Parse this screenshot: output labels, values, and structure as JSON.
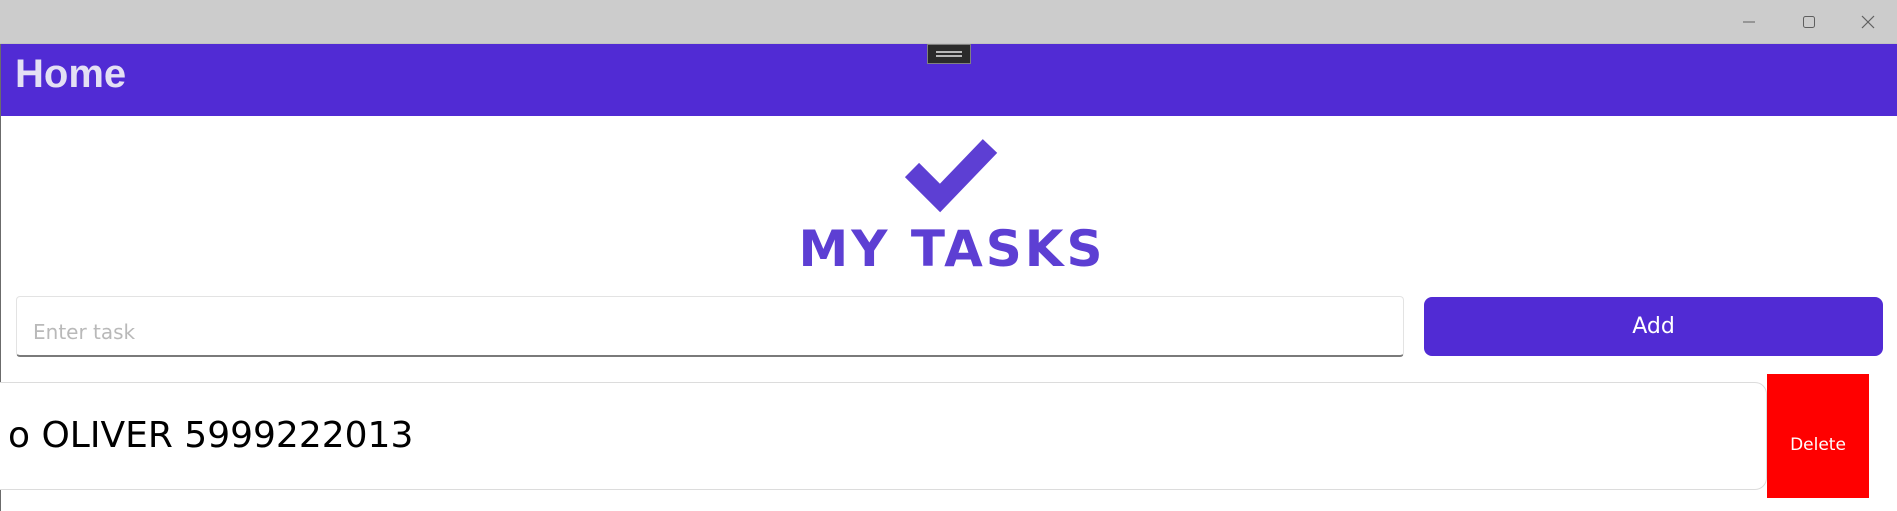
{
  "window": {
    "controls": {
      "minimize_icon": "minimize-icon",
      "maximize_icon": "maximize-icon",
      "close_icon": "close-icon"
    }
  },
  "navbar": {
    "title": "Home",
    "background": "#512bd4"
  },
  "logo": {
    "icon": "checkmark-icon",
    "text": "MY TASKS",
    "color": "#5d3fd3"
  },
  "task_entry": {
    "placeholder": "Enter task",
    "value": ""
  },
  "add_button": {
    "label": "Add",
    "color": "#512bd4"
  },
  "tasks": [
    {
      "text": "o OLIVER 5999222013",
      "delete_label": "Delete",
      "delete_color": "#ff0000"
    }
  ]
}
